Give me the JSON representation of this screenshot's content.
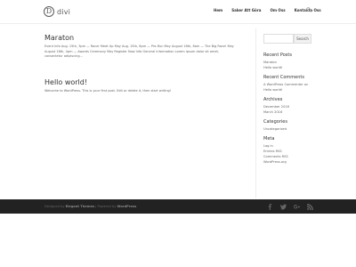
{
  "site": {
    "logo_letter": "D",
    "logo_text": "divi"
  },
  "nav": {
    "items": [
      "Hem",
      "Saker Att Göra",
      "Om Oss",
      "Kontakta Oss"
    ]
  },
  "posts": [
    {
      "title": "Maraton",
      "excerpt_line1": "Event Info Aug. 15th, 3pm — Racer Meet Up May Aug. 15th, 6pm — Pre-Run May August 16th, 8am — The Big Race! May",
      "excerpt_line2": "August 18th, 4pm — Awards Ceremony May Register Now Info General Information Lorem ipsum dolor sit amet,",
      "excerpt_line3": "consectetur adipiscing..."
    },
    {
      "title": "Hello world!",
      "excerpt_line1": "Welcome to WordPress. This is your first post. Edit or delete it, then start writing!"
    }
  ],
  "sidebar": {
    "search_button": "Search",
    "widgets": [
      {
        "title": "Recent Posts",
        "items": [
          "Maraton",
          "Hello world!"
        ]
      },
      {
        "title": "Recent Comments",
        "items": [
          "A WordPress Commenter on",
          "Hello world!"
        ]
      },
      {
        "title": "Archives",
        "items": [
          "December 2016",
          "March 2016"
        ]
      },
      {
        "title": "Categories",
        "items": [
          "Uncategorized"
        ]
      },
      {
        "title": "Meta",
        "items": [
          "Log in",
          "Entries RSS",
          "Comments RSS",
          "WordPress.org"
        ]
      }
    ]
  },
  "footer": {
    "designed_by": "Designed by",
    "theme_name": "Elegant Themes",
    "separator": " | Powered by ",
    "powered": "WordPress",
    "social_icons": [
      "facebook-icon",
      "twitter-icon",
      "google-plus-icon",
      "rss-icon"
    ]
  }
}
